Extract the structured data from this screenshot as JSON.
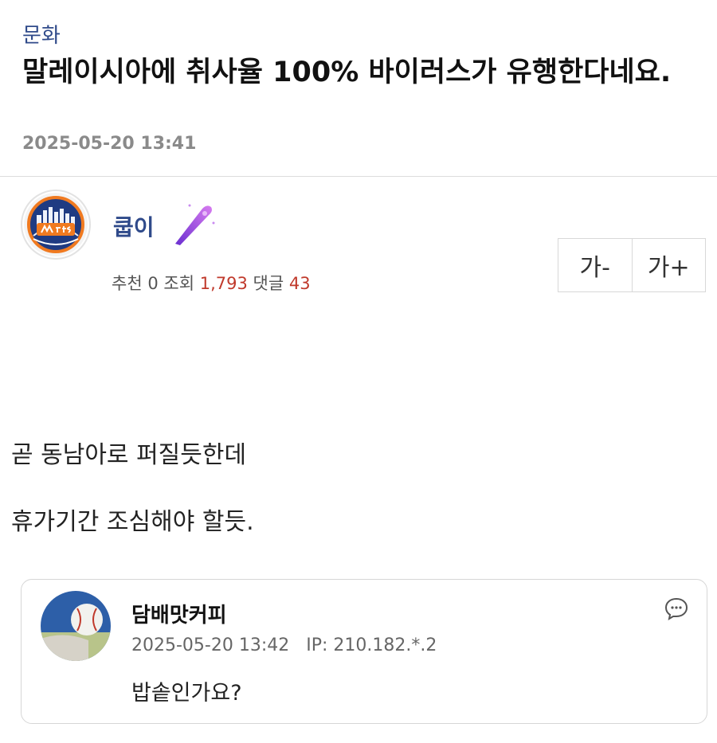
{
  "post": {
    "category": "문화",
    "title": "말레이시아에 취사율 100% 바이러스가 유행한다네요.",
    "date": "2025-05-20 13:41"
  },
  "author": {
    "nickname": "쿱이",
    "avatar_icon": "mets-logo-icon",
    "badge_icon": "purple-bat-icon"
  },
  "stats": {
    "recommend_label": "추천",
    "recommend": "0",
    "views_label": "조회",
    "views": "1,793",
    "comments_label": "댓글",
    "comments": "43"
  },
  "font_controls": {
    "decrease": "가-",
    "increase": "가+"
  },
  "body": {
    "lines": [
      "곧 동남아로 퍼질듯한데",
      "휴가기간 조심해야 할듯."
    ]
  },
  "comment": {
    "author": "담배맛커피",
    "date": "2025-05-20 13:42",
    "ip": "IP: 210.182.*.2",
    "text": "밥솥인가요?",
    "avatar_icon": "baseball-avatar-icon",
    "menu_icon": "speech-bubble-icon"
  },
  "colors": {
    "category": "#2f4a8a",
    "nickname": "#2f4a8a",
    "highlight_numbers": "#c0392b",
    "date": "#8a8a8a"
  }
}
